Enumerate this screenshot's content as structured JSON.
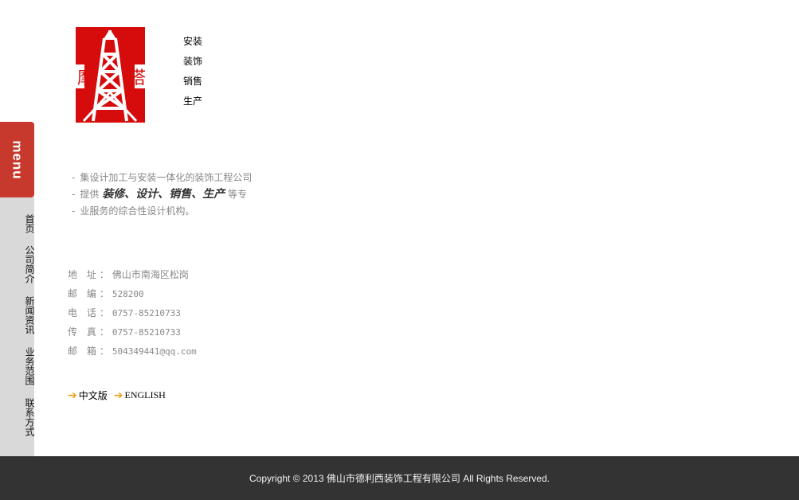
{
  "logo": {
    "chars": [
      "摩",
      "塔"
    ],
    "color": "#d60b0b"
  },
  "taglines": [
    "安装",
    "装饰",
    "销售",
    "生产"
  ],
  "sidebar": {
    "menu_label": "menu",
    "accent": "#c8392d",
    "items": [
      {
        "label": "首页"
      },
      {
        "label": "公司简介"
      },
      {
        "label": "新闻资讯"
      },
      {
        "label": "业务范围"
      },
      {
        "label": "联系方式"
      }
    ]
  },
  "intro": {
    "line1": "集设计加工与安装一体化的装饰工程公司",
    "line2_prefix": "提供",
    "line2_strong": "装修、设计、销售、生产",
    "line2_suffix": "等专",
    "line3": "业服务的综合性设计机构。"
  },
  "contact": {
    "rows": [
      {
        "label": "地 址：",
        "value": "佛山市南海区松岗"
      },
      {
        "label": "邮 编：",
        "value": "528200"
      },
      {
        "label": "电 话：",
        "value": "0757-85210733"
      },
      {
        "label": "传 真：",
        "value": "0757-85210733"
      },
      {
        "label": "邮 箱：",
        "value": "504349441@qq.com"
      }
    ]
  },
  "languages": {
    "arrow": "➔",
    "items": [
      "中文版",
      "ENGLISH"
    ]
  },
  "footer": {
    "text": "Copyright © 2013 佛山市德利西装饰工程有限公司  All Rights Reserved."
  }
}
